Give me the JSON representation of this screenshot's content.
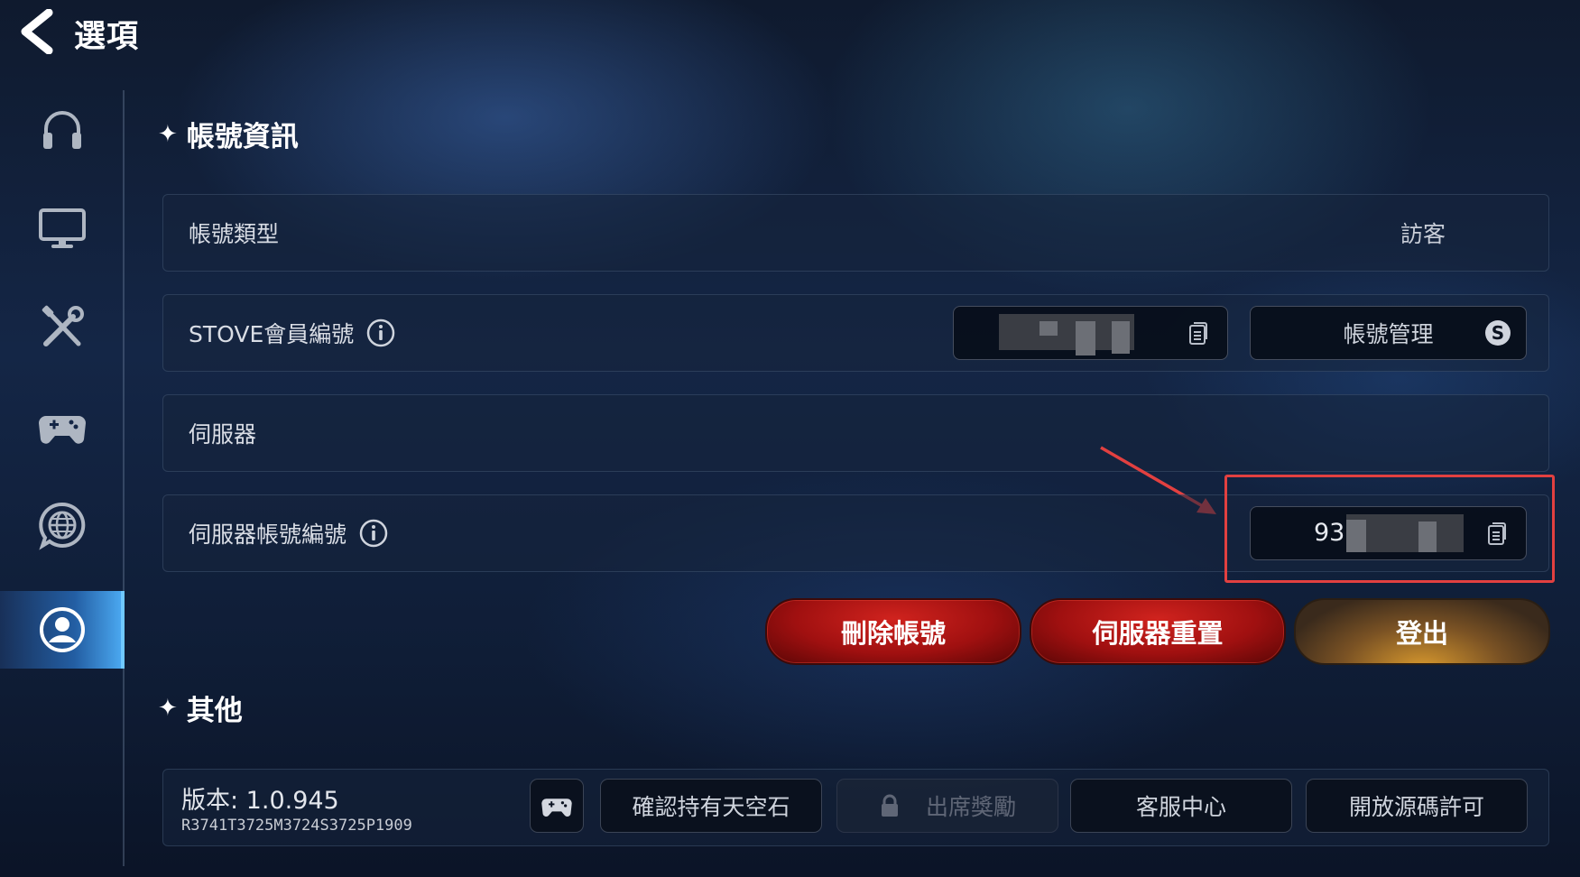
{
  "header": {
    "title": "選項",
    "back_icon": "chevron-left-icon"
  },
  "sidebar": {
    "items": [
      {
        "icon": "headphones-icon",
        "active": false
      },
      {
        "icon": "monitor-icon",
        "active": false
      },
      {
        "icon": "tools-icon",
        "active": false
      },
      {
        "icon": "gamepad-icon",
        "active": false
      },
      {
        "icon": "globe-chat-icon",
        "active": false
      },
      {
        "icon": "user-icon",
        "active": true
      }
    ]
  },
  "account_section": {
    "title": "帳號資訊",
    "account_type": {
      "label": "帳號類型",
      "value": "訪客"
    },
    "stove_id": {
      "label": "STOVE會員編號",
      "info_icon": "info-icon",
      "copy_icon": "copy-icon"
    },
    "account_manage_button": "帳號管理",
    "server": {
      "label": "伺服器"
    },
    "server_account_id": {
      "label": "伺服器帳號編號",
      "value_prefix": "93",
      "copy_icon": "copy-icon"
    },
    "buttons": {
      "delete": "刪除帳號",
      "server_reset": "伺服器重置",
      "logout": "登出"
    }
  },
  "other_section": {
    "title": "其他",
    "version": "版本: 1.0.945",
    "build": "R3741T3725M3724S3725P1909",
    "buttons": {
      "confirm_skystone": "確認持有天空石",
      "attendance": "出席獎勵",
      "support": "客服中心",
      "open_source": "開放源碼許可"
    }
  },
  "colors": {
    "highlight": "#e24040",
    "red_button": "#a01010",
    "gold_button": "#d99a2e",
    "active_tab": "#6fc8ff"
  }
}
